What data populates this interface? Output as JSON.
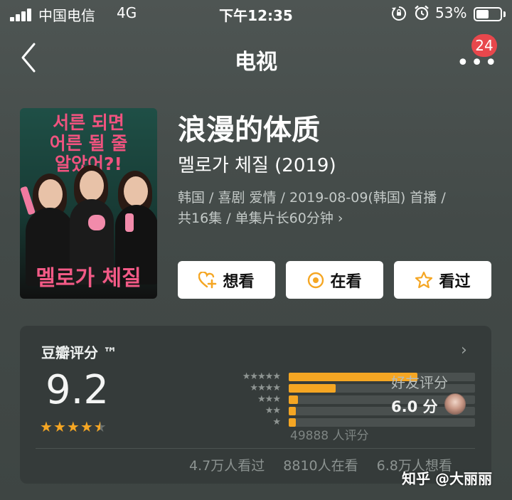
{
  "status_bar": {
    "carrier": "中国电信",
    "network": "4G",
    "time": "下午12:35",
    "battery_percent": "53%",
    "battery_level": 0.53
  },
  "nav": {
    "title": "电视",
    "more_badge": "24",
    "icons": {
      "back": "chevron-left-icon",
      "more": "more-dots-icon"
    }
  },
  "poster": {
    "tagline_lines": [
      "서른 되면",
      "어른 될 줄",
      "알았어?!"
    ],
    "logo_text": "멜로가 체질",
    "colors": {
      "background": "#1f4f46",
      "accent": "#f0537f"
    }
  },
  "show": {
    "title": "浪漫的体质",
    "original_title": "멜로가 체질 (2019)",
    "meta_line1": "韩国 / 喜剧 爱情 / 2019-08-09(韩国) 首播 /",
    "meta_line2": "共16集 / 单集片长60分钟"
  },
  "actions": [
    {
      "label": "想看",
      "icon": "heart-plus-icon"
    },
    {
      "label": "在看",
      "icon": "watching-icon"
    },
    {
      "label": "看过",
      "icon": "star-outline-icon"
    }
  ],
  "rating": {
    "heading": "豆瓣评分 ™",
    "score": "9.2",
    "stars_value": 4.5,
    "distribution": [
      {
        "stars": 5,
        "fraction": 0.69
      },
      {
        "stars": 4,
        "fraction": 0.25
      },
      {
        "stars": 3,
        "fraction": 0.05
      },
      {
        "stars": 2,
        "fraction": 0.01
      },
      {
        "stars": 1,
        "fraction": 0.01
      }
    ],
    "count": "49888 人评分",
    "friend_label": "好友评分",
    "friend_score": "6.0 分",
    "stats": {
      "watched": "4.7万人看过",
      "watching": "8810人在看",
      "want": "6.8万人想看"
    },
    "accent_color": "#f5a623"
  },
  "watermark": "知乎 @大丽丽"
}
